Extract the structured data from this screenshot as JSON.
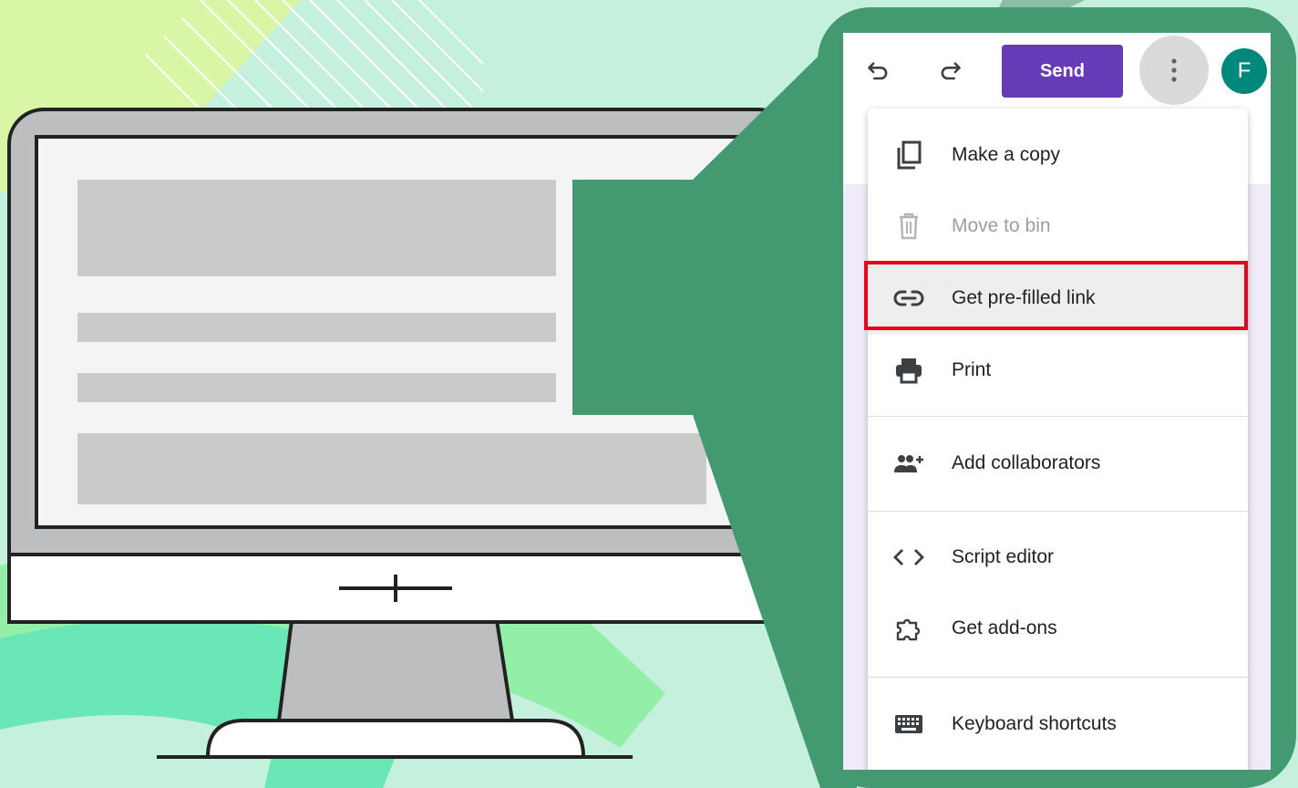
{
  "colors": {
    "background": "#c6f0de",
    "accent_green": "#439a71",
    "send_purple": "#673ab7",
    "avatar_teal": "#00897b",
    "highlight_red": "#e4061a"
  },
  "toolbar": {
    "undo_icon": "undo-icon",
    "redo_icon": "redo-icon",
    "send_label": "Send",
    "more_icon": "more-vert-icon",
    "avatar_initial": "F"
  },
  "menu": {
    "items": [
      {
        "label": "Make a copy",
        "icon": "copy-icon"
      },
      {
        "label": "Move to bin",
        "icon": "trash-icon",
        "disabled": true
      },
      {
        "label": "Get pre-filled link",
        "icon": "link-icon",
        "highlighted": true
      },
      {
        "label": "Print",
        "icon": "printer-icon"
      },
      {
        "label": "Add collaborators",
        "icon": "add-people-icon"
      },
      {
        "label": "Script editor",
        "icon": "code-icon"
      },
      {
        "label": "Get add-ons",
        "icon": "puzzle-icon"
      },
      {
        "label": "Keyboard shortcuts",
        "icon": "keyboard-icon"
      }
    ]
  }
}
